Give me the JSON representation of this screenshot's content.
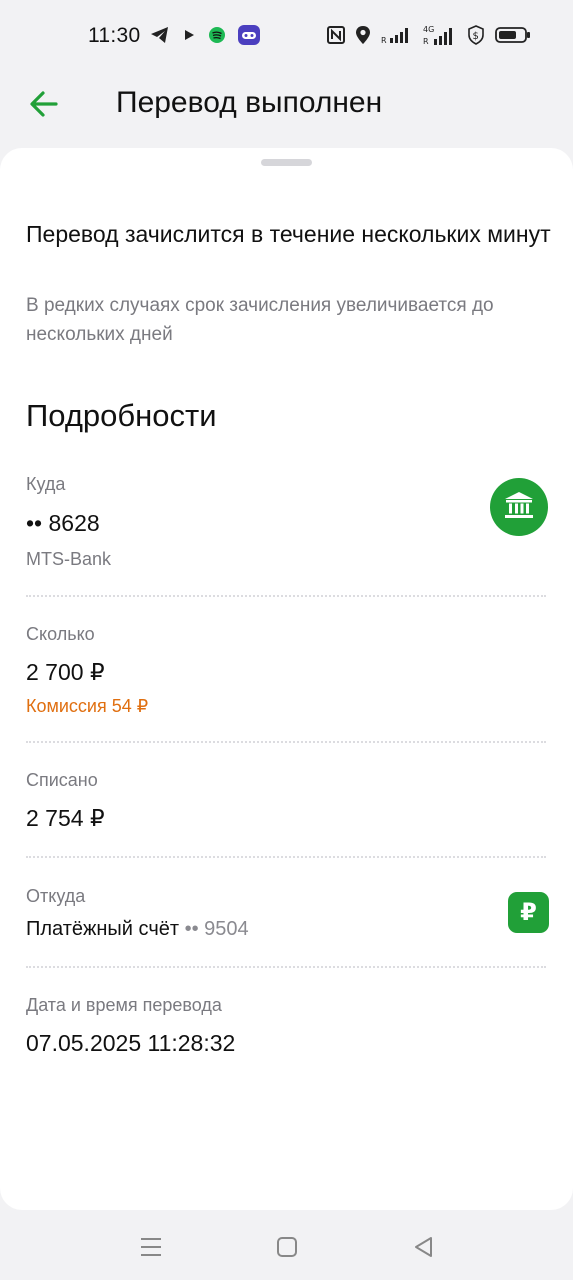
{
  "status_bar": {
    "time": "11:30",
    "left_icons": [
      "telegram-icon",
      "play-icon",
      "spotify-icon",
      "gamepad-icon"
    ],
    "right_icons": [
      "nfc-icon",
      "location-icon",
      "signal-icon",
      "signal-4g-icon",
      "shield-dollar-icon",
      "battery-icon"
    ]
  },
  "header": {
    "title": "Перевод выполнен",
    "back_icon": "arrow-left-icon"
  },
  "notice": {
    "title": "Перевод зачислится в течение нескольких минут",
    "subtitle": "В редких случаях срок зачисления увеличивается до нескольких дней"
  },
  "details": {
    "heading": "Подробности",
    "to": {
      "label": "Куда",
      "value": "•• 8628",
      "bank": "MTS-Bank",
      "icon": "bank-icon"
    },
    "amount": {
      "label": "Сколько",
      "value": "2 700 ₽",
      "commission": "Комиссия 54 ₽"
    },
    "debited": {
      "label": "Списано",
      "value": "2 754 ₽"
    },
    "from": {
      "label": "Откуда",
      "account_name": "Платёжный счёт",
      "account_mask": "•• 9504",
      "icon_symbol": "₽"
    },
    "datetime": {
      "label": "Дата и время перевода",
      "value": "07.05.2025 11:28:32"
    }
  },
  "nav_bar": {
    "icons": [
      "menu-icon",
      "home-icon",
      "back-icon"
    ]
  },
  "colors": {
    "accent": "#21a038",
    "commission": "#e06f10",
    "secondary_text": "#7a7a80"
  }
}
